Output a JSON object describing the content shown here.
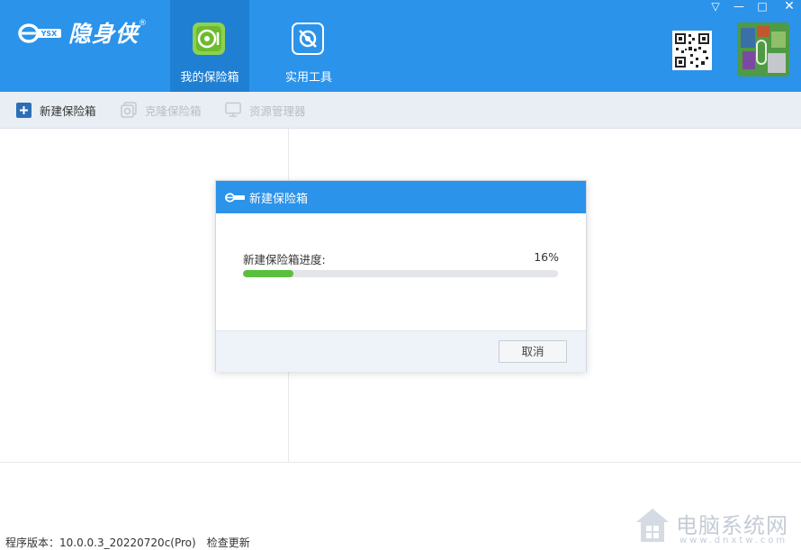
{
  "app": {
    "logo_text": "隐身侠",
    "logo_badge": "YSX",
    "registered_mark": "®"
  },
  "header": {
    "tabs": [
      {
        "label": "我的保险箱",
        "icon": "safe-icon",
        "active": true
      },
      {
        "label": "实用工具",
        "icon": "tools-icon",
        "active": false
      }
    ],
    "window_controls": {
      "dropdown": "▽",
      "minimize": "—",
      "maximize": "□",
      "close": "✕"
    }
  },
  "toolbar": {
    "items": [
      {
        "label": "新建保险箱",
        "icon": "plus-icon",
        "enabled": true
      },
      {
        "label": "克隆保险箱",
        "icon": "clone-icon",
        "enabled": false
      },
      {
        "label": "资源管理器",
        "icon": "monitor-icon",
        "enabled": false
      }
    ]
  },
  "dialog": {
    "title": "新建保险箱",
    "progress_label": "新建保险箱进度:",
    "progress_text": "16%",
    "progress_value": 0.16,
    "cancel_label": "取消"
  },
  "status": {
    "version": "程序版本：10.0.0.3_20220720c(Pro)",
    "check_update": "检查更新"
  },
  "watermark": {
    "text": "电脑系统网",
    "url": "www.dnxtw.com"
  },
  "colors": {
    "header_bg": "#2b93ea",
    "active_tab_bg": "#1f7fd3",
    "progress_fill": "#5bbf3e",
    "toolbar_bg": "#e9eef4"
  }
}
